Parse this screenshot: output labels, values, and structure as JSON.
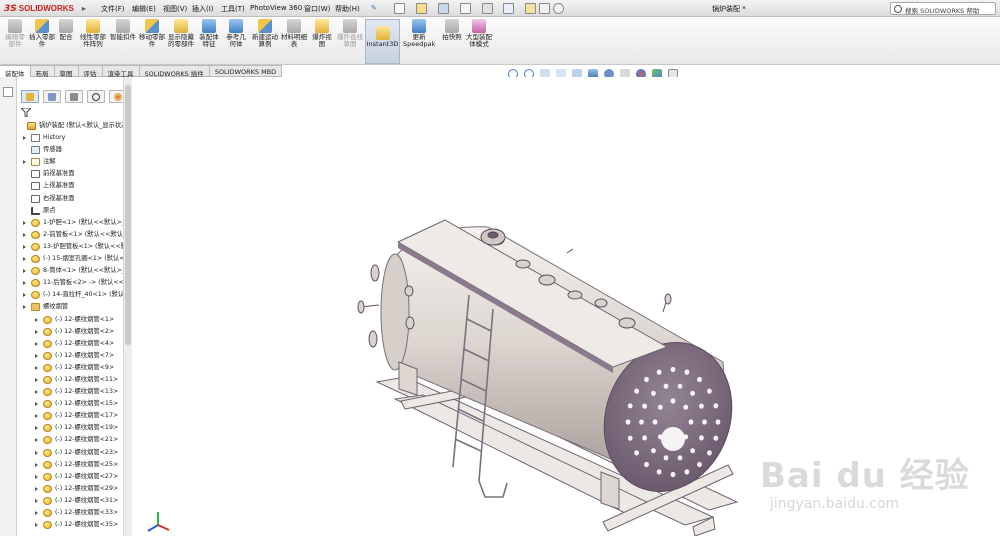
{
  "app": {
    "logo_prefix": "3S",
    "logo_text": "SOLIDWORKS",
    "document_title": "锅炉装配 *",
    "search_placeholder": "搜索 SOLIDWORKS 帮助"
  },
  "menu": [
    {
      "label": "文件(F)"
    },
    {
      "label": "编辑(E)"
    },
    {
      "label": "视图(V)"
    },
    {
      "label": "插入(I)"
    },
    {
      "label": "工具(T)"
    },
    {
      "label": "PhotoView 360"
    },
    {
      "label": "窗口(W)"
    },
    {
      "label": "帮助(H)"
    }
  ],
  "command_manager": [
    {
      "label": "编辑零部件",
      "icon": "edit-component-icon",
      "enabled": false
    },
    {
      "label": "插入零部件",
      "icon": "insert-component-icon",
      "enabled": true
    },
    {
      "label": "配合",
      "icon": "mate-icon",
      "enabled": true
    },
    {
      "label": "线性零部件阵列",
      "icon": "linear-pattern-icon",
      "enabled": true
    },
    {
      "label": "智能扣件",
      "icon": "smart-fasteners-icon",
      "enabled": true
    },
    {
      "label": "移动零部件",
      "icon": "move-component-icon",
      "enabled": true
    },
    {
      "label": "显示隐藏的零部件",
      "icon": "show-hidden-icon",
      "enabled": true
    },
    {
      "label": "装配体特征",
      "icon": "assembly-features-icon",
      "enabled": true
    },
    {
      "label": "参考几何体",
      "icon": "reference-geometry-icon",
      "enabled": true
    },
    {
      "label": "新建运动算例",
      "icon": "new-motion-study-icon",
      "enabled": true
    },
    {
      "label": "材料明细表",
      "icon": "bom-icon",
      "enabled": true
    },
    {
      "label": "爆炸视图",
      "icon": "exploded-view-icon",
      "enabled": true
    },
    {
      "label": "爆炸直线草图",
      "icon": "explode-line-sketch-icon",
      "enabled": false
    },
    {
      "label": "Instant3D",
      "icon": "instant3d-icon",
      "enabled": true,
      "active": true
    },
    {
      "label": "更新Speedpak",
      "icon": "speedpak-icon",
      "enabled": true
    },
    {
      "label": "拍快照",
      "icon": "snapshot-icon",
      "enabled": true
    },
    {
      "label": "大型装配体模式",
      "icon": "large-assembly-icon",
      "enabled": true
    }
  ],
  "tabs": [
    {
      "label": "装配体",
      "active": true
    },
    {
      "label": "布局"
    },
    {
      "label": "草图"
    },
    {
      "label": "评估"
    },
    {
      "label": "渲染工具"
    },
    {
      "label": "SOLIDWORKS 插件"
    },
    {
      "label": "SOLIDWORKS MBD"
    }
  ],
  "feature_tree": [
    {
      "label": "锅炉装配 (默认<默认_显示状态-1>)",
      "icon": "assembly-icon",
      "level": 0,
      "expander": false
    },
    {
      "label": "History",
      "icon": "history-icon",
      "level": 1,
      "expander": true
    },
    {
      "label": "传感器",
      "icon": "sensor-icon",
      "level": 1,
      "expander": false
    },
    {
      "label": "注解",
      "icon": "annotation-icon",
      "level": 1,
      "expander": true
    },
    {
      "label": "前视基准面",
      "icon": "plane-icon",
      "level": 1,
      "expander": false
    },
    {
      "label": "上视基准面",
      "icon": "plane-icon",
      "level": 1,
      "expander": false
    },
    {
      "label": "右视基准面",
      "icon": "plane-icon",
      "level": 1,
      "expander": false
    },
    {
      "label": "原点",
      "icon": "origin-icon",
      "level": 1,
      "expander": false
    },
    {
      "label": "1-炉胆<1> (默认<<默认>_显示状态 1>)",
      "icon": "part-icon",
      "level": 1,
      "expander": true
    },
    {
      "label": "2-前管板<1> (默认<<默认>_显示状态 1>)",
      "icon": "part-icon",
      "level": 1,
      "expander": true
    },
    {
      "label": "13-炉胆管板<1> (默认<<默认>_显示状态 1>)",
      "icon": "part-icon",
      "level": 1,
      "expander": true
    },
    {
      "label": "(-) 15-烟室孔圈<1> (默认<<默认>_显示状态 1>)",
      "icon": "part-icon",
      "level": 1,
      "expander": true
    },
    {
      "label": "8-筒体<1> (默认<<默认>_显示状态 1>)",
      "icon": "part-icon",
      "level": 1,
      "expander": true
    },
    {
      "label": "11-后管板<2> -> (默认<<默认>_显示状态 1>)",
      "icon": "part-icon",
      "level": 1,
      "expander": true
    },
    {
      "label": "(-) 14-直拉杆_40<1> (默认<<默认>_显示状态 1>)",
      "icon": "part-icon",
      "level": 1,
      "expander": true
    },
    {
      "label": "螺纹烟管",
      "icon": "folder-icon",
      "level": 1,
      "expander": true
    },
    {
      "label": "(-) 12-螺纹烟管<1>",
      "icon": "part-icon",
      "level": 2,
      "expander": true
    },
    {
      "label": "(-) 12-螺纹烟管<2>",
      "icon": "part-icon",
      "level": 2,
      "expander": true
    },
    {
      "label": "(-) 12-螺纹烟管<4>",
      "icon": "part-icon",
      "level": 2,
      "expander": true
    },
    {
      "label": "(-) 12-螺纹烟管<7>",
      "icon": "part-icon",
      "level": 2,
      "expander": true
    },
    {
      "label": "(-) 12-螺纹烟管<9>",
      "icon": "part-icon",
      "level": 2,
      "expander": true
    },
    {
      "label": "(-) 12-螺纹烟管<11>",
      "icon": "part-icon",
      "level": 2,
      "expander": true
    },
    {
      "label": "(-) 12-螺纹烟管<13>",
      "icon": "part-icon",
      "level": 2,
      "expander": true
    },
    {
      "label": "(-) 12-螺纹烟管<15>",
      "icon": "part-icon",
      "level": 2,
      "expander": true
    },
    {
      "label": "(-) 12-螺纹烟管<17>",
      "icon": "part-icon",
      "level": 2,
      "expander": true
    },
    {
      "label": "(-) 12-螺纹烟管<19>",
      "icon": "part-icon",
      "level": 2,
      "expander": true
    },
    {
      "label": "(-) 12-螺纹烟管<21>",
      "icon": "part-icon",
      "level": 2,
      "expander": true
    },
    {
      "label": "(-) 12-螺纹烟管<23>",
      "icon": "part-icon",
      "level": 2,
      "expander": true
    },
    {
      "label": "(-) 12-螺纹烟管<25>",
      "icon": "part-icon",
      "level": 2,
      "expander": true
    },
    {
      "label": "(-) 12-螺纹烟管<27>",
      "icon": "part-icon",
      "level": 2,
      "expander": true
    },
    {
      "label": "(-) 12-螺纹烟管<29>",
      "icon": "part-icon",
      "level": 2,
      "expander": true
    },
    {
      "label": "(-) 12-螺纹烟管<31>",
      "icon": "part-icon",
      "level": 2,
      "expander": true
    },
    {
      "label": "(-) 12-螺纹烟管<33>",
      "icon": "part-icon",
      "level": 2,
      "expander": true
    },
    {
      "label": "(-) 12-螺纹烟管<35>",
      "icon": "part-icon",
      "level": 2,
      "expander": true
    }
  ],
  "watermark": {
    "main": "Bai du 经验",
    "sub": "jingyan.baidu.com"
  },
  "colors": {
    "brand_red": "#cc1f1f",
    "model_shell": "#dcd6d2",
    "model_frame": "#7a6a7d",
    "toolbar_bg": "#f1f1f1"
  }
}
